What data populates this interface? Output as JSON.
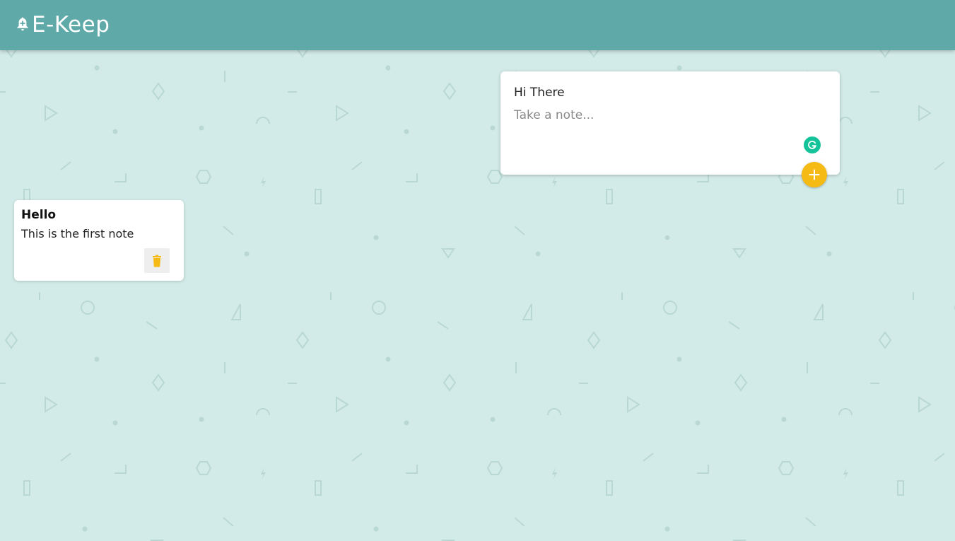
{
  "app": {
    "title": "E-Keep"
  },
  "create_note": {
    "title_value": "Hi There",
    "content_placeholder": "Take a note...",
    "add_icon": "plus-icon",
    "extension_icon": "grammarly-icon"
  },
  "notes": [
    {
      "title": "Hello",
      "content": "This is the first note",
      "delete_icon": "trash-icon"
    }
  ],
  "colors": {
    "header": "#5fa9a9",
    "background": "#d3ebe8",
    "accent": "#f5ba13",
    "grammarly": "#15c39a"
  }
}
